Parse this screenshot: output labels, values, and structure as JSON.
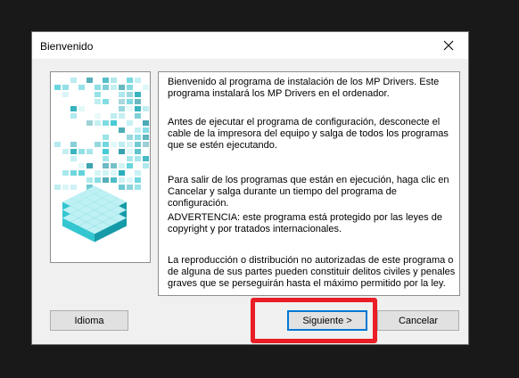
{
  "dialog": {
    "title": "Bienvenido",
    "close_icon": "close-icon",
    "paragraphs": [
      "Bienvenido al programa de instalación de los MP Drivers. Este programa instalará los MP Drivers en el ordenador.",
      "Antes de ejecutar el programa de configuración, desconecte el cable de la impresora del equipo y salga de todos los programas que se estén ejecutando.",
      "Para salir de los programas que están en ejecución, haga clic en Cancelar y salga durante un tiempo del programa de configuración.",
      "ADVERTENCIA: este programa está protegido por las leyes de copyright y por tratados internacionales.",
      "La reproducción o distribución no autorizadas de este programa o de alguna de sus partes pueden constituir delitos civiles y penales graves que se perseguirán hasta el máximo permitido por la ley."
    ],
    "buttons": {
      "language": "Idioma",
      "next": "Siguiente >",
      "cancel": "Cancelar"
    }
  },
  "colors": {
    "highlight": "#ea1e26",
    "accent": "#0078d7",
    "art_teal": "#2fc4cf"
  }
}
